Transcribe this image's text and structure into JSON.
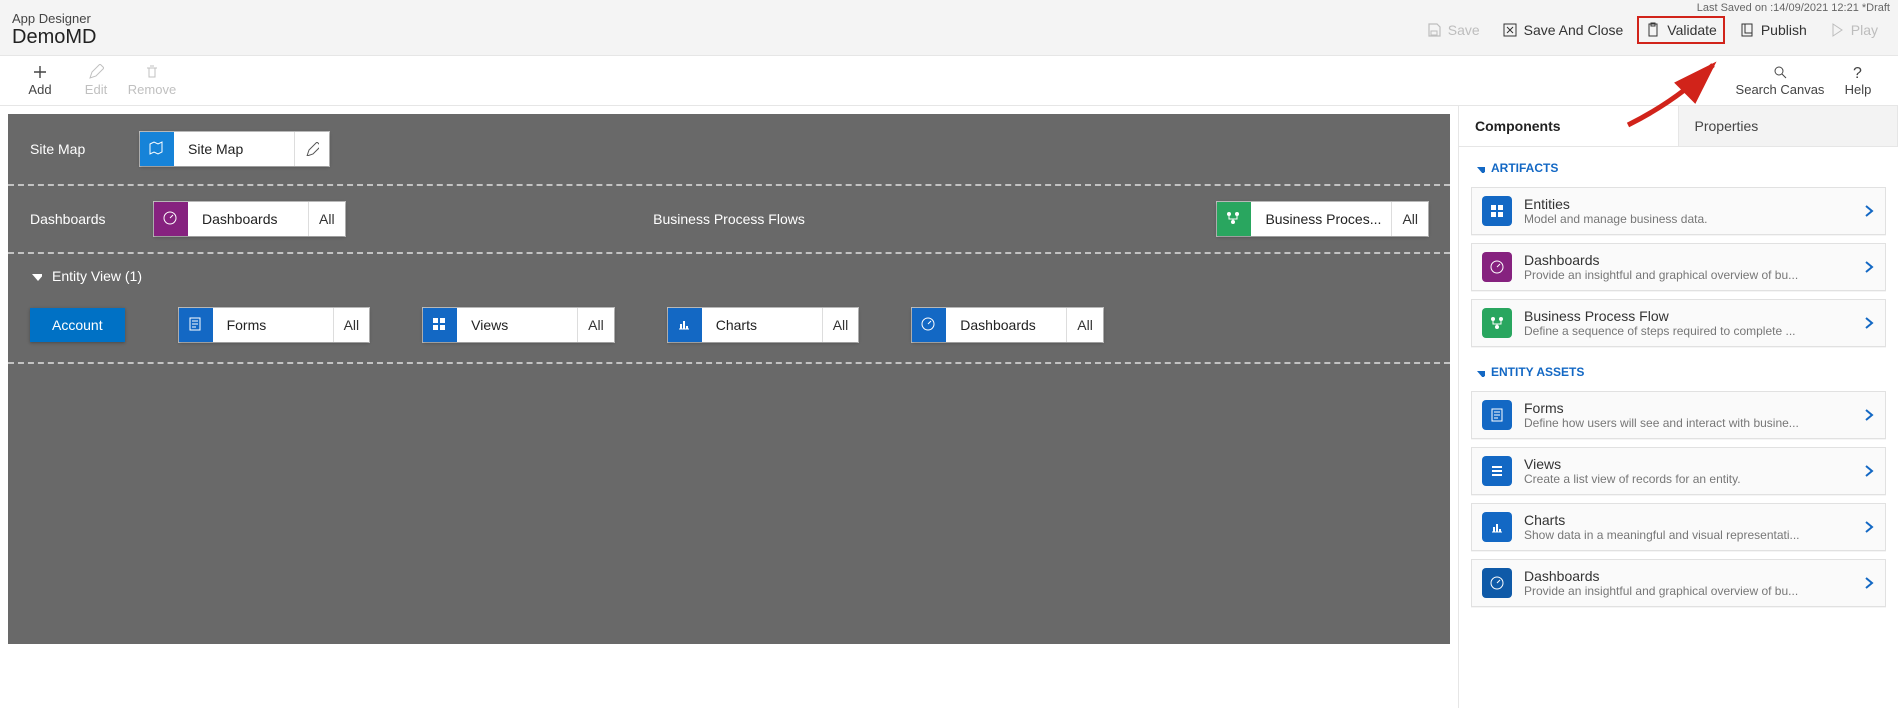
{
  "header": {
    "subtitle": "App Designer",
    "title": "DemoMD",
    "last_saved": "Last Saved on :14/09/2021 12:21 *Draft",
    "save": "Save",
    "save_close": "Save And Close",
    "validate": "Validate",
    "publish": "Publish",
    "play": "Play"
  },
  "toolbar": {
    "add": "Add",
    "edit": "Edit",
    "remove": "Remove",
    "search": "Search Canvas",
    "help": "Help"
  },
  "canvas": {
    "sitemap_label": "Site Map",
    "sitemap_tile": "Site Map",
    "dashboards_label": "Dashboards",
    "dashboards_tile": "Dashboards",
    "all": "All",
    "bpf_label": "Business Process Flows",
    "bpf_tile": "Business Proces...",
    "entity_header": "Entity View (1)",
    "account": "Account",
    "forms": "Forms",
    "views": "Views",
    "charts": "Charts",
    "dashboards2": "Dashboards"
  },
  "panel": {
    "tab_components": "Components",
    "tab_properties": "Properties",
    "section_artifacts": "ARTIFACTS",
    "section_assets": "ENTITY ASSETS",
    "cards": {
      "entities": {
        "t": "Entities",
        "d": "Model and manage business data."
      },
      "dashboards": {
        "t": "Dashboards",
        "d": "Provide an insightful and graphical overview of bu..."
      },
      "bpf": {
        "t": "Business Process Flow",
        "d": "Define a sequence of steps required to complete ..."
      },
      "forms": {
        "t": "Forms",
        "d": "Define how users will see and interact with busine..."
      },
      "views": {
        "t": "Views",
        "d": "Create a list view of records for an entity."
      },
      "charts": {
        "t": "Charts",
        "d": "Show data in a meaningful and visual representati..."
      },
      "dash2": {
        "t": "Dashboards",
        "d": "Provide an insightful and graphical overview of bu..."
      }
    }
  }
}
